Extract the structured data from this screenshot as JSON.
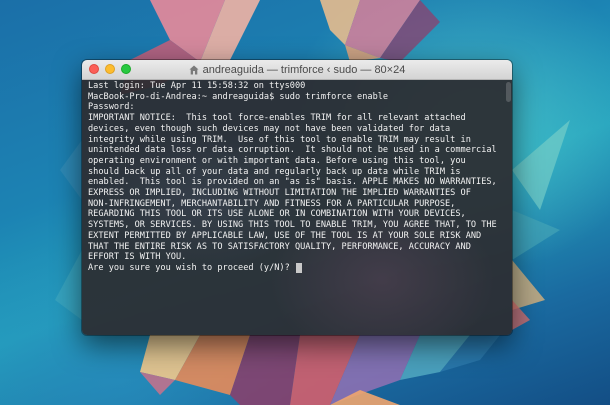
{
  "window": {
    "title": "andreaguida — trimforce ‹ sudo — 80×24",
    "title_icon": "house-icon"
  },
  "colors": {
    "close": "#fc5f57",
    "minimize": "#fdbc2e",
    "zoom": "#28c840",
    "terminal_text": "#f2f2f2"
  },
  "terminal": {
    "lines": [
      "Last login: Tue Apr 11 15:58:32 on ttys000",
      "MacBook-Pro-di-Andrea:~ andreaguida$ sudo trimforce enable",
      "Password:",
      "IMPORTANT NOTICE:  This tool force-enables TRIM for all relevant attached",
      "devices, even though such devices may not have been validated for data",
      "integrity while using TRIM.  Use of this tool to enable TRIM may result in",
      "unintended data loss or data corruption.  It should not be used in a commercial",
      "operating environment or with important data. Before using this tool, you",
      "should back up all of your data and regularly back up data while TRIM is",
      "enabled.  This tool is provided on an \"as is\" basis. APPLE MAKES NO WARRANTIES,",
      "EXPRESS OR IMPLIED, INCLUDING WITHOUT LIMITATION THE IMPLIED WARRANTIES OF",
      "NON-INFRINGEMENT, MERCHANTABILITY AND FITNESS FOR A PARTICULAR PURPOSE,",
      "REGARDING THIS TOOL OR ITS USE ALONE OR IN COMBINATION WITH YOUR DEVICES,",
      "SYSTEMS, OR SERVICES. BY USING THIS TOOL TO ENABLE TRIM, YOU AGREE THAT, TO THE",
      "EXTENT PERMITTED BY APPLICABLE LAW, USE OF THE TOOL IS AT YOUR SOLE RISK AND",
      "THAT THE ENTIRE RISK AS TO SATISFACTORY QUALITY, PERFORMANCE, ACCURACY AND",
      "EFFORT IS WITH YOU."
    ],
    "prompt": "Are you sure you wish to proceed (y/N)? "
  }
}
